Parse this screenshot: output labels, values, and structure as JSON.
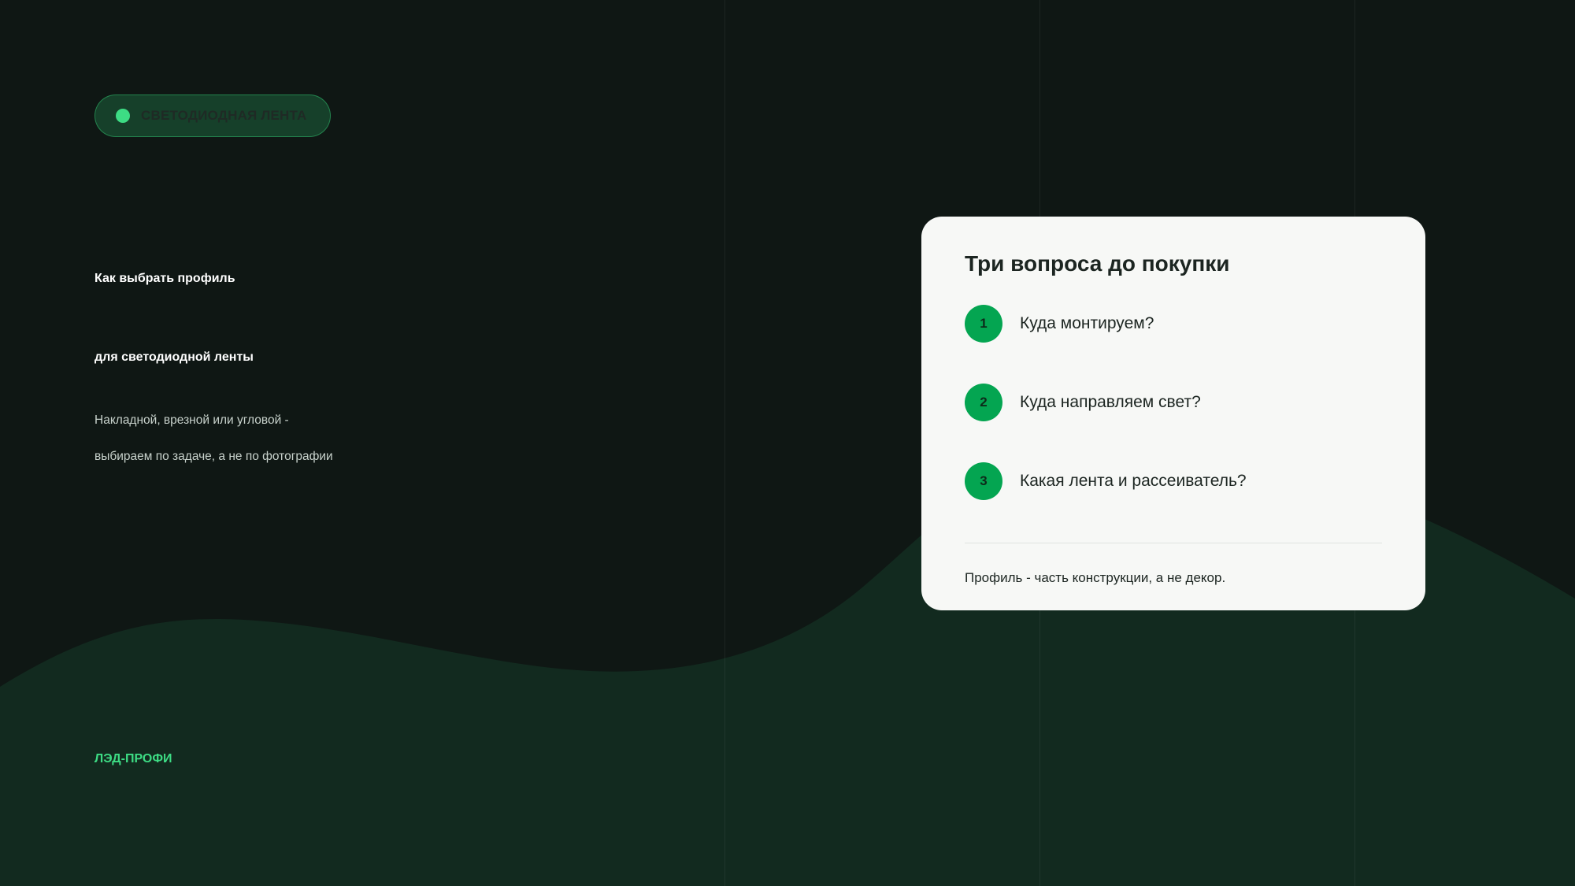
{
  "badge": {
    "label": "СВЕТОДИОДНАЯ ЛЕНТА",
    "dot_color": "#3ddc84"
  },
  "hero": {
    "title_line1": "Как выбрать профиль",
    "title_line2": "для светодиодной ленты",
    "lead_line1": "Накладной, врезной или угловой -",
    "lead_line2": "выбираем по задаче, а не по фотографии"
  },
  "brand": {
    "name": "ЛЭД-ПРОФИ"
  },
  "card": {
    "title": "Три вопроса до покупки",
    "questions": [
      {
        "number": "1",
        "text": "Куда монтируем?"
      },
      {
        "number": "2",
        "text": "Куда направляем свет?"
      },
      {
        "number": "3",
        "text": "Какая лента и рассеиватель?"
      }
    ],
    "footnote": "Профиль - часть конструкции, а не декор."
  },
  "colors": {
    "background": "#0f1714",
    "wave": "#122a1f",
    "accent": "#3ddc84",
    "number_badge": "#04a551",
    "card_background": "#f7f8f6"
  }
}
